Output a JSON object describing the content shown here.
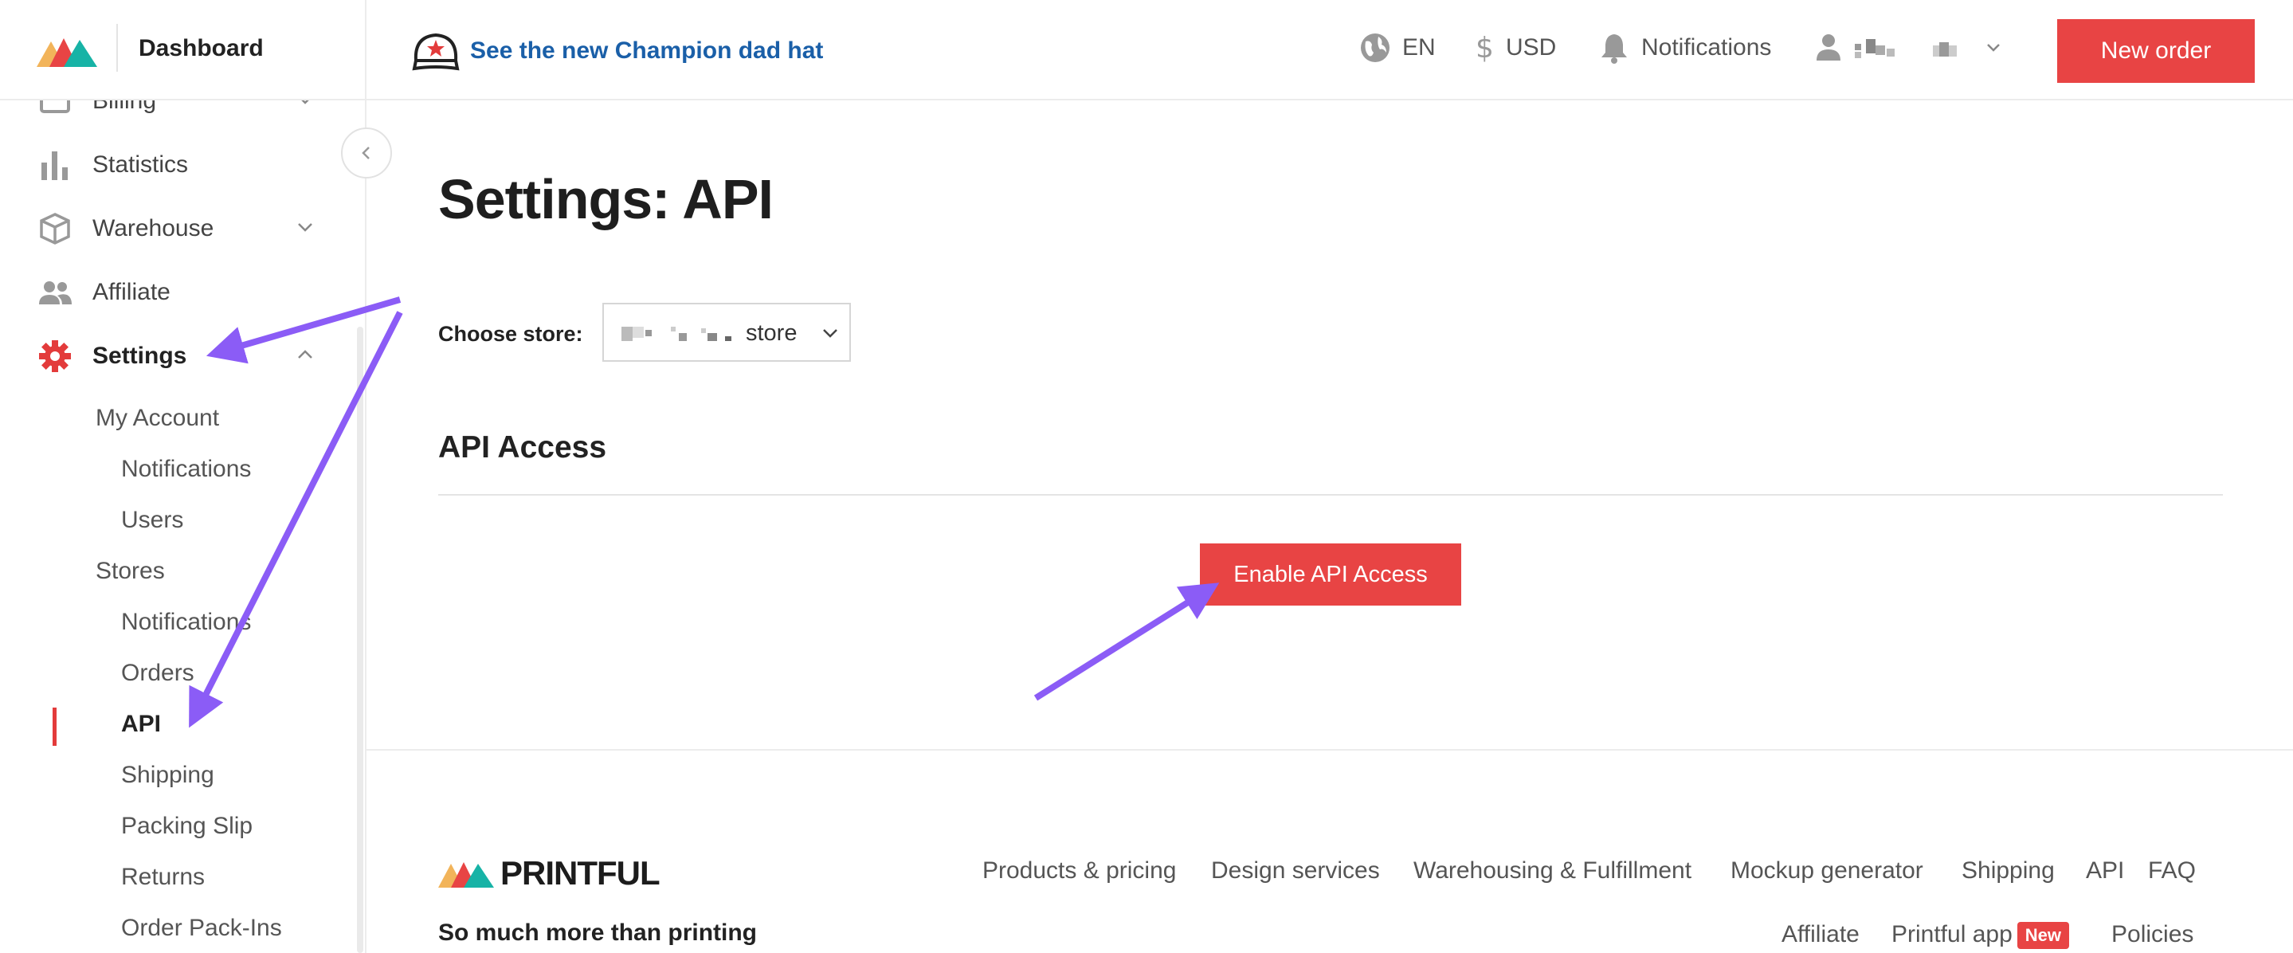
{
  "sidebar": {
    "title": "Dashboard",
    "items": [
      {
        "label": "Billing",
        "icon": "billing-icon"
      },
      {
        "label": "Statistics",
        "icon": "bar-chart-icon"
      },
      {
        "label": "Warehouse",
        "icon": "box-icon"
      },
      {
        "label": "Affiliate",
        "icon": "people-icon"
      },
      {
        "label": "Settings",
        "icon": "gear-icon"
      }
    ],
    "settings_sub": {
      "my_account": "My Account",
      "account_notifications": "Notifications",
      "users": "Users",
      "stores": "Stores",
      "store_notifications": "Notifications",
      "orders": "Orders",
      "api": "API",
      "shipping": "Shipping",
      "packing_slip": "Packing Slip",
      "returns": "Returns",
      "order_pack_ins": "Order Pack-Ins"
    }
  },
  "header": {
    "promo": "See the new Champion dad hat",
    "language": "EN",
    "currency": "USD",
    "notifications": "Notifications",
    "new_order": "New order"
  },
  "main": {
    "title": "Settings: API",
    "choose_store_label": "Choose store:",
    "store_value": "store",
    "section_heading": "API Access",
    "enable_button": "Enable API Access"
  },
  "footer": {
    "brand": "PRINTFUL",
    "tagline": "So much more than printing",
    "links_row1": [
      "Products & pricing",
      "Design services",
      "Warehousing & Fulfillment",
      "Mockup generator",
      "Shipping",
      "API",
      "FAQ"
    ],
    "links_row2": [
      "Affiliate",
      "Printful app",
      "Policies"
    ],
    "new_badge": "New"
  },
  "colors": {
    "accent_red": "#e84444",
    "link_blue": "#1a5fa8",
    "annotation_purple": "#8b5cf6"
  }
}
